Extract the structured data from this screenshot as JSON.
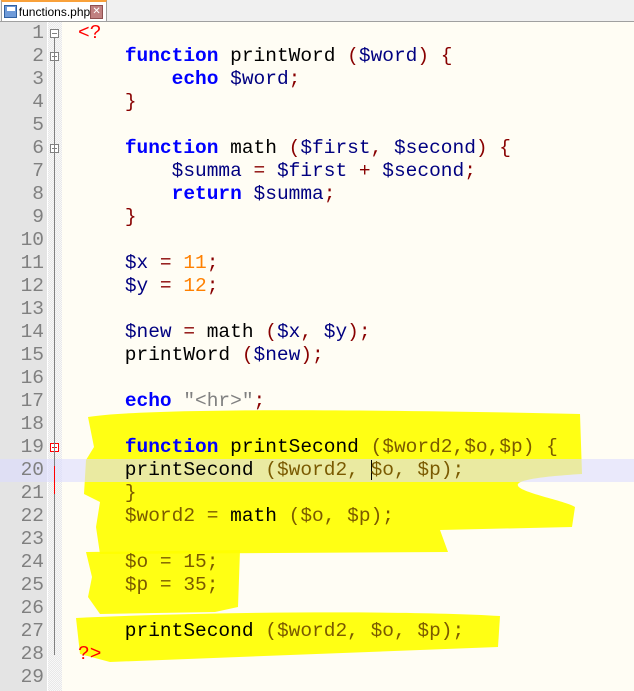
{
  "tab": {
    "title": "functions.php",
    "close": "✕"
  },
  "colors": {
    "keyword": "#0000ff",
    "variable": "#000080",
    "operator": "#880000",
    "number": "#ff8000",
    "string": "#808080",
    "php_tag": "#ff0000",
    "highlight": "#ffff00",
    "current_line": "#e8e8ff"
  },
  "current_line": 20,
  "lines": [
    [
      [
        "php",
        "<?"
      ]
    ],
    [
      [
        "fn",
        "    "
      ],
      [
        "kw",
        "function"
      ],
      [
        "fn",
        " printWord "
      ],
      [
        "op",
        "("
      ],
      [
        "var",
        "$word"
      ],
      [
        "op",
        ") {"
      ]
    ],
    [
      [
        "fn",
        "        "
      ],
      [
        "kw",
        "echo"
      ],
      [
        "fn",
        " "
      ],
      [
        "var",
        "$word"
      ],
      [
        "op",
        ";"
      ]
    ],
    [
      [
        "fn",
        "    "
      ],
      [
        "op",
        "}"
      ]
    ],
    [],
    [
      [
        "fn",
        "    "
      ],
      [
        "kw",
        "function"
      ],
      [
        "fn",
        " math "
      ],
      [
        "op",
        "("
      ],
      [
        "var",
        "$first"
      ],
      [
        "op",
        ", "
      ],
      [
        "var",
        "$second"
      ],
      [
        "op",
        ") {"
      ]
    ],
    [
      [
        "fn",
        "        "
      ],
      [
        "var",
        "$summa"
      ],
      [
        "op",
        " = "
      ],
      [
        "var",
        "$first"
      ],
      [
        "op",
        " + "
      ],
      [
        "var",
        "$second"
      ],
      [
        "op",
        ";"
      ]
    ],
    [
      [
        "fn",
        "        "
      ],
      [
        "kw",
        "return"
      ],
      [
        "fn",
        " "
      ],
      [
        "var",
        "$summa"
      ],
      [
        "op",
        ";"
      ]
    ],
    [
      [
        "fn",
        "    "
      ],
      [
        "op",
        "}"
      ]
    ],
    [],
    [
      [
        "fn",
        "    "
      ],
      [
        "var",
        "$x"
      ],
      [
        "op",
        " = "
      ],
      [
        "num",
        "11"
      ],
      [
        "op",
        ";"
      ]
    ],
    [
      [
        "fn",
        "    "
      ],
      [
        "var",
        "$y"
      ],
      [
        "op",
        " = "
      ],
      [
        "num",
        "12"
      ],
      [
        "op",
        ";"
      ]
    ],
    [],
    [
      [
        "fn",
        "    "
      ],
      [
        "var",
        "$new"
      ],
      [
        "op",
        " = "
      ],
      [
        "fn",
        "math "
      ],
      [
        "op",
        "("
      ],
      [
        "var",
        "$x"
      ],
      [
        "op",
        ", "
      ],
      [
        "var",
        "$y"
      ],
      [
        "op",
        ");"
      ]
    ],
    [
      [
        "fn",
        "    printWord "
      ],
      [
        "op",
        "("
      ],
      [
        "var",
        "$new"
      ],
      [
        "op",
        ");"
      ]
    ],
    [],
    [
      [
        "fn",
        "    "
      ],
      [
        "kw",
        "echo"
      ],
      [
        "fn",
        " "
      ],
      [
        "str",
        "\"<hr>\""
      ],
      [
        "op",
        ";"
      ]
    ],
    [],
    [
      [
        "fn",
        "    "
      ],
      [
        "kw",
        "function"
      ],
      [
        "fn",
        " printSecond "
      ],
      [
        "op",
        "("
      ],
      [
        "var",
        "$word2"
      ],
      [
        "op",
        ","
      ],
      [
        "var",
        "$o"
      ],
      [
        "op",
        ","
      ],
      [
        "var",
        "$p"
      ],
      [
        "op",
        ") {"
      ]
    ],
    [
      [
        "fn",
        "    printSecond "
      ],
      [
        "op",
        "("
      ],
      [
        "var",
        "$word2"
      ],
      [
        "op",
        ", "
      ],
      [
        "caret",
        ""
      ],
      [
        "var",
        "$o"
      ],
      [
        "op",
        ", "
      ],
      [
        "var",
        "$p"
      ],
      [
        "op",
        ");"
      ]
    ],
    [
      [
        "fn",
        "    "
      ],
      [
        "op",
        "}"
      ]
    ],
    [
      [
        "fn",
        "    "
      ],
      [
        "var",
        "$word2"
      ],
      [
        "op",
        " = "
      ],
      [
        "fn",
        "math "
      ],
      [
        "op",
        "("
      ],
      [
        "var",
        "$o"
      ],
      [
        "op",
        ", "
      ],
      [
        "var",
        "$p"
      ],
      [
        "op",
        ");"
      ]
    ],
    [],
    [
      [
        "fn",
        "    "
      ],
      [
        "var",
        "$o"
      ],
      [
        "op",
        " = "
      ],
      [
        "num",
        "15"
      ],
      [
        "op",
        ";"
      ]
    ],
    [
      [
        "fn",
        "    "
      ],
      [
        "var",
        "$p"
      ],
      [
        "op",
        " = "
      ],
      [
        "num",
        "35"
      ],
      [
        "op",
        ";"
      ]
    ],
    [],
    [
      [
        "fn",
        "    printSecond "
      ],
      [
        "op",
        "("
      ],
      [
        "var",
        "$word2"
      ],
      [
        "op",
        ", "
      ],
      [
        "var",
        "$o"
      ],
      [
        "op",
        ", "
      ],
      [
        "var",
        "$p"
      ],
      [
        "op",
        ");"
      ]
    ],
    [
      [
        "php",
        "?>"
      ]
    ],
    []
  ]
}
